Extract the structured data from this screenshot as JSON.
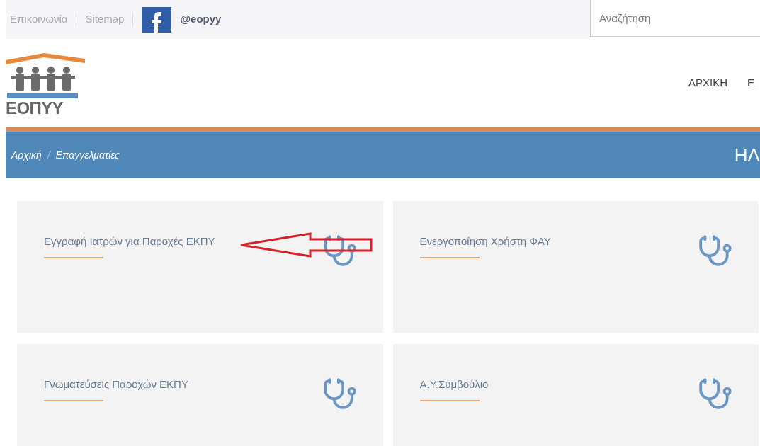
{
  "top_bar": {
    "links": [
      "Επικοινωνία",
      "Sitemap"
    ],
    "facebook": "@eopyy",
    "search": {
      "placeholder": "Αναζήτηση"
    }
  },
  "header": {
    "logo_text": "ΕΟΠΥΥ",
    "nav": [
      "ΑΡΧΙΚΗ",
      "Ε"
    ]
  },
  "breadcrumb": {
    "items": [
      "Αρχική",
      "Επαγγελματίες"
    ],
    "separator": "/",
    "right_title": "ΗΛ"
  },
  "cards": [
    {
      "title": "Εγγραφή Ιατρών για Παροχές ΕΚΠΥ",
      "annotated": true
    },
    {
      "title": "Ενεργοποίηση Χρήστη ΦΑΥ",
      "annotated": false
    },
    {
      "title": "Γνωματεύσεις Παροχών ΕΚΠΥ",
      "annotated": false
    },
    {
      "title": "Α.Υ.Συμβούλιο",
      "annotated": false
    }
  ]
}
